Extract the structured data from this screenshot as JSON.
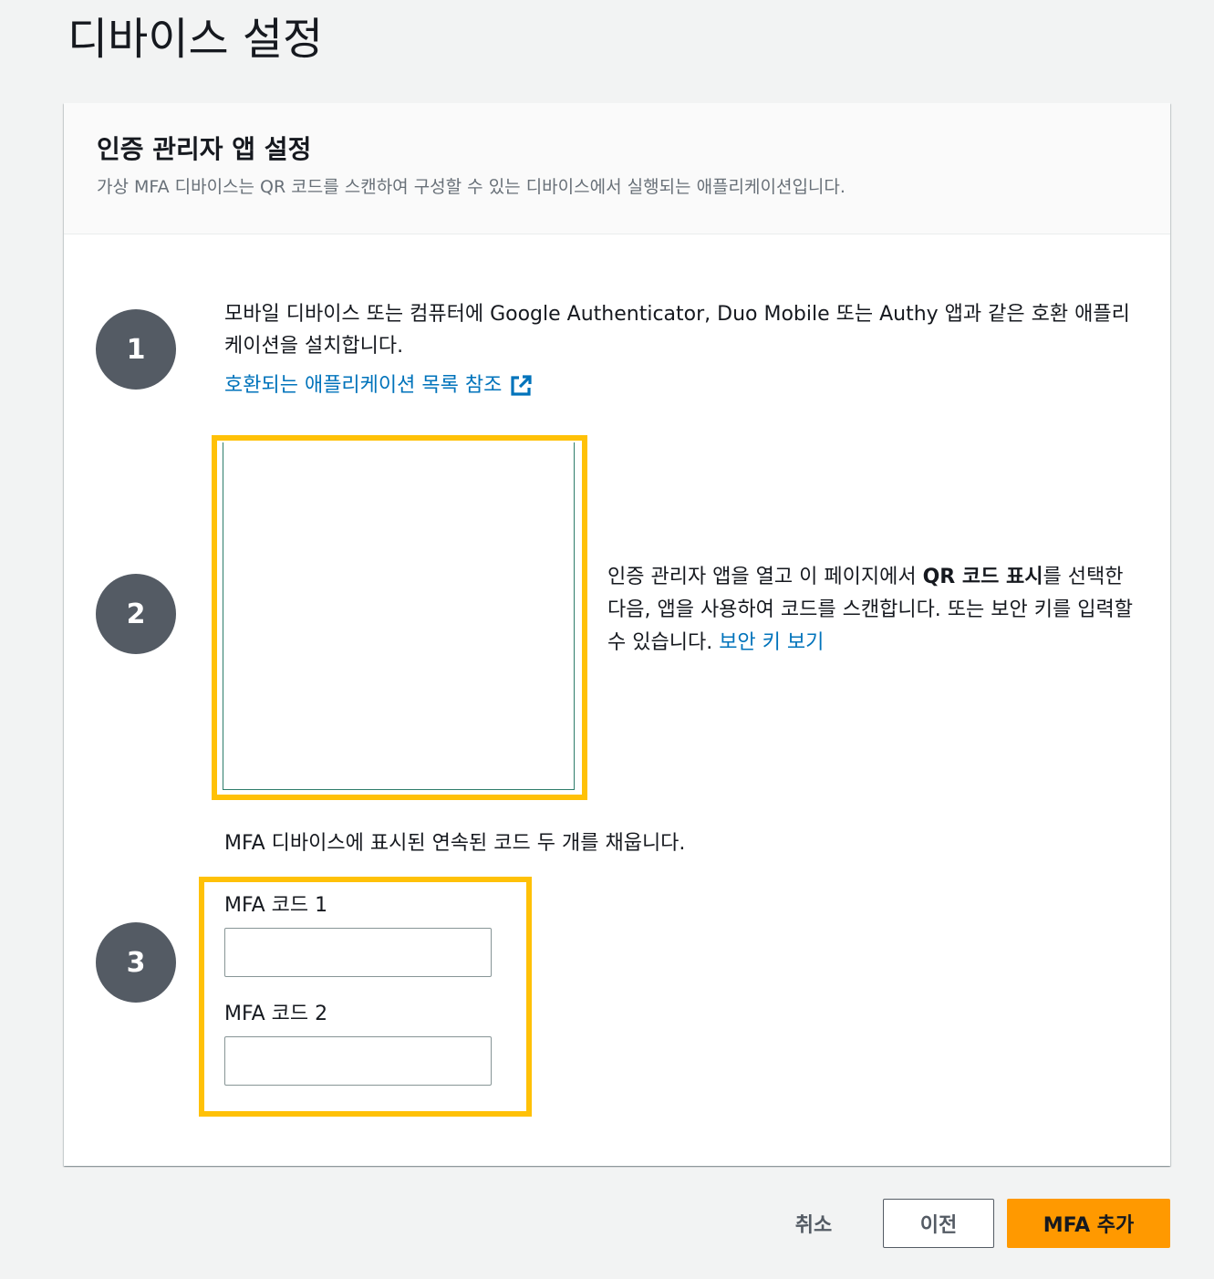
{
  "page": {
    "title": "디바이스 설정"
  },
  "panel": {
    "title": "인증 관리자 앱 설정",
    "description": "가상 MFA 디바이스는 QR 코드를 스캔하여 구성할 수 있는 디바이스에서 실행되는 애플리케이션입니다."
  },
  "steps": {
    "step1": {
      "number": "1",
      "text": "모바일 디바이스 또는 컴퓨터에 Google Authenticator, Duo Mobile 또는 Authy 앱과 같은 호환 애플리케이션을 설치합니다.",
      "link": "호환되는 애플리케이션 목록 참조"
    },
    "step2": {
      "number": "2",
      "text_before": "인증 관리자 앱을 열고 이 페이지에서 ",
      "text_bold": "QR 코드 표시",
      "text_after": "를 선택한 다음, 앱을 사용하여 코드를 스캔합니다. 또는 보안 키를 입력할 수 있습니다. ",
      "link": "보안 키 보기"
    },
    "step3": {
      "number": "3",
      "intro": "MFA 디바이스에 표시된 연속된 코드 두 개를 채웁니다.",
      "code1_label": "MFA 코드 1",
      "code1_value": "",
      "code2_label": "MFA 코드 2",
      "code2_value": ""
    }
  },
  "actions": {
    "cancel": "취소",
    "previous": "이전",
    "add_mfa": "MFA 추가"
  },
  "colors": {
    "highlight": "#ffc107",
    "primary_button": "#ff9900",
    "link": "#0073bb",
    "step_circle": "#545b64"
  },
  "icons": {
    "external_link": "external-link-icon"
  }
}
